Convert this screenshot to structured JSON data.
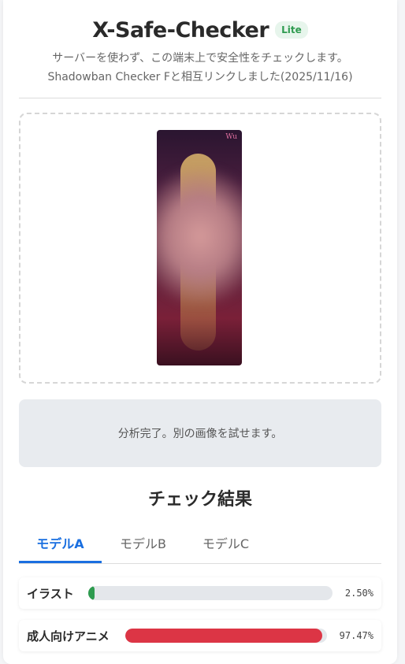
{
  "header": {
    "title": "X-Safe-Checker",
    "badge": "Lite",
    "subtitle_line1": "サーバーを使わず、この端末上で安全性をチェックします。",
    "subtitle_line2": "Shadowban Checker Fと相互リンクしました(2025/11/16)"
  },
  "preview": {
    "signature": "Wu"
  },
  "status": {
    "message": "分析完了。別の画像を試せます。"
  },
  "results": {
    "title": "チェック結果",
    "tabs": [
      {
        "label": "モデルA",
        "active": true
      },
      {
        "label": "モデルB",
        "active": false
      },
      {
        "label": "モデルC",
        "active": false
      }
    ],
    "rows": [
      {
        "label": "イラスト",
        "value_text": "2.50%",
        "value": 0.025,
        "color": "#2e9b4f"
      },
      {
        "label": "成人向けアニメ",
        "value_text": "97.47%",
        "value": 0.9747,
        "color": "#dc3545"
      }
    ]
  },
  "colors": {
    "accent": "#1a6fe0",
    "badge_green": "#2e9b4f",
    "danger_red": "#dc3545"
  }
}
